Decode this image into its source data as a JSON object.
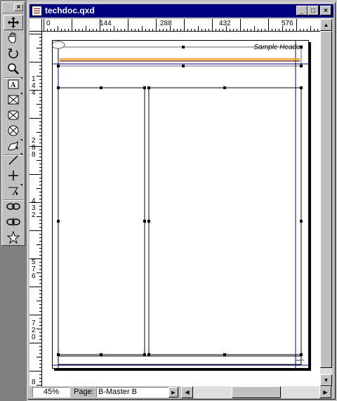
{
  "palette": {
    "close_label": "×"
  },
  "tools": [
    {
      "name": "item-tool-icon"
    },
    {
      "name": "content-tool-icon"
    },
    {
      "name": "rotation-tool-icon"
    },
    {
      "name": "zoom-tool-icon"
    },
    {
      "name": "text-box-tool-icon"
    },
    {
      "name": "rectangle-picture-box-tool-icon"
    },
    {
      "name": "picture-box-tool-icon"
    },
    {
      "name": "oval-picture-box-tool-icon"
    },
    {
      "name": "bezier-picture-box-tool-icon"
    },
    {
      "name": "line-tool-icon"
    },
    {
      "name": "orthogonal-line-tool-icon"
    },
    {
      "name": "bezier-line-tool-icon"
    },
    {
      "name": "linking-tool-icon"
    },
    {
      "name": "unlinking-tool-icon"
    },
    {
      "name": "star-tool-icon"
    }
  ],
  "window": {
    "title": "techdoc.qxd",
    "minimize_label": "_",
    "maximize_label": "□",
    "close_label": "×"
  },
  "ruler_top": {
    "labels": [
      "0",
      "144",
      "288",
      "432",
      "576"
    ]
  },
  "ruler_left": {
    "labels": [
      "1",
      "4",
      "4",
      "2",
      "8",
      "8",
      "4",
      "3",
      "2",
      "5",
      "7",
      "6",
      "7",
      "2",
      "0",
      "8"
    ]
  },
  "document": {
    "header_text": "Sample Header",
    "footer_text": "page #",
    "header_rule_color": "#f0a020",
    "header_rule_dark_color": "#803000",
    "margin_guide_color": "#000080"
  },
  "status": {
    "zoom": "45%",
    "page_label": "Page:",
    "page_value": "B-Master B"
  },
  "scroll": {
    "up_icon": "▲",
    "down_icon": "▼",
    "left_icon": "◀",
    "right_icon": "▶",
    "dropdown_icon": "▶"
  }
}
